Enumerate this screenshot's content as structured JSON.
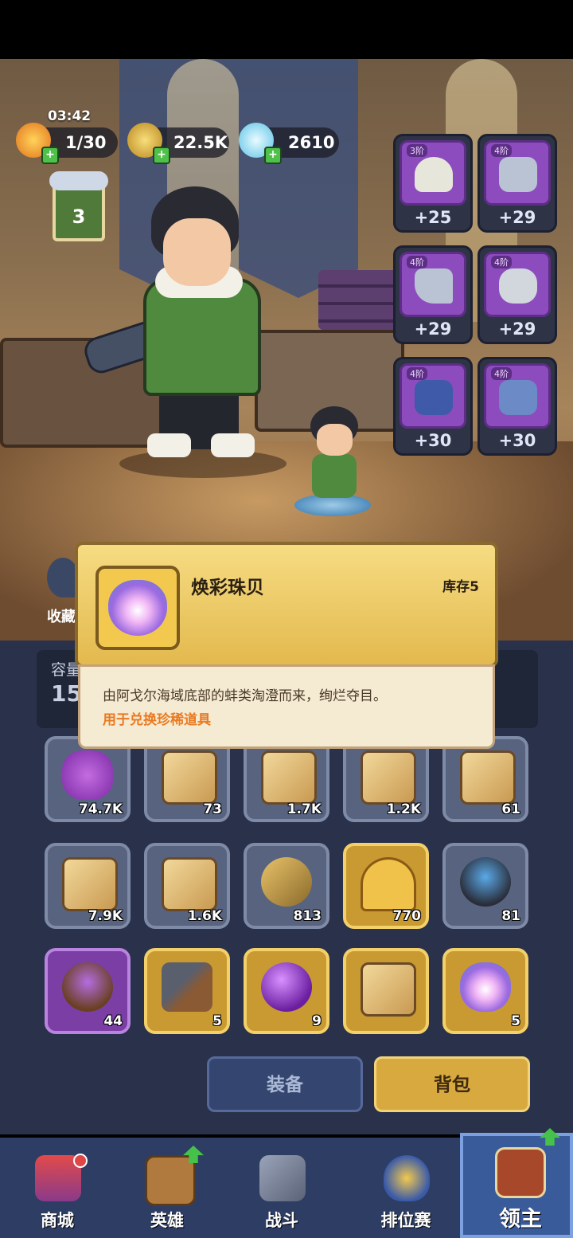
{
  "hud": {
    "timer": "03:42",
    "energy": "1/30",
    "gold": "22.5K",
    "crystal": "2610",
    "level": "3",
    "favorite_label": "收藏"
  },
  "equipment_slots": [
    {
      "tier": "3阶",
      "bonus": "+25",
      "icon": "helmet-icon"
    },
    {
      "tier": "4阶",
      "bonus": "+29",
      "icon": "armor-icon"
    },
    {
      "tier": "4阶",
      "bonus": "+29",
      "icon": "boots-icon"
    },
    {
      "tier": "4阶",
      "bonus": "+29",
      "icon": "gloves-icon"
    },
    {
      "tier": "4阶",
      "bonus": "+30",
      "icon": "pants-icon"
    },
    {
      "tier": "4阶",
      "bonus": "+30",
      "icon": "shorts-icon"
    }
  ],
  "capacity": {
    "label": "容量",
    "value": "15"
  },
  "tooltip": {
    "title": "焕彩珠贝",
    "stock": "库存5",
    "description": "由阿戈尔海域底部的蚌类淘澄而来，绚烂夺目。",
    "usage": "用于兑换珍稀道具"
  },
  "inventory": [
    {
      "count": "74.7K",
      "icon": "purple-slime-icon",
      "style": "normal"
    },
    {
      "count": "73",
      "icon": "pants-scroll-icon",
      "style": "normal"
    },
    {
      "count": "1.7K",
      "icon": "armor-scroll-icon",
      "style": "normal"
    },
    {
      "count": "1.2K",
      "icon": "gloves-scroll-icon",
      "style": "normal"
    },
    {
      "count": "61",
      "icon": "coat-scroll-icon",
      "style": "normal"
    },
    {
      "count": "7.9K",
      "icon": "helmet-scroll-icon",
      "style": "normal"
    },
    {
      "count": "1.6K",
      "icon": "boots-scroll-icon",
      "style": "normal"
    },
    {
      "count": "813",
      "icon": "bolt-nut-icon",
      "style": "normal"
    },
    {
      "count": "770",
      "icon": "golden-key-icon",
      "style": "gold"
    },
    {
      "count": "81",
      "icon": "mortar-icon",
      "style": "normal"
    },
    {
      "count": "44",
      "icon": "purple-mortar-icon",
      "style": "purple"
    },
    {
      "count": "5",
      "icon": "pickaxe-icon",
      "style": "gold"
    },
    {
      "count": "9",
      "icon": "purple-orb-icon",
      "style": "gold"
    },
    {
      "count": "",
      "icon": "star-scroll-icon",
      "style": "gold"
    },
    {
      "count": "5",
      "icon": "pearl-shell-icon",
      "style": "gold"
    }
  ],
  "tabs": {
    "equip": "装备",
    "bag": "背包"
  },
  "nav": [
    {
      "label": "商城",
      "icon": "shop-icon"
    },
    {
      "label": "英雄",
      "icon": "hero-card-icon"
    },
    {
      "label": "战斗",
      "icon": "battle-swords-icon"
    },
    {
      "label": "排位赛",
      "icon": "rank-shield-icon"
    },
    {
      "label": "领主",
      "icon": "lord-banner-icon"
    }
  ]
}
